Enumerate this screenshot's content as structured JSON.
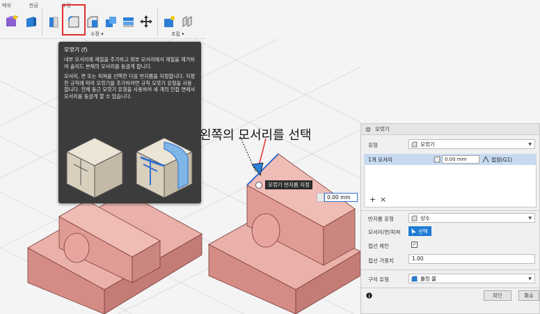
{
  "toolbar": {
    "groups": [
      "메쉬",
      "판금",
      "수정"
    ],
    "sub_modify": "수정 ▾",
    "sub_assemble": "조립 ▾"
  },
  "tooltip": {
    "title": "모깎기 (f)",
    "para1": "내부 모서리에 재질을 추가하고 외부 모서리에서 재질을 제거하여 솔리드 본체의 모서리를 둥글게 합니다.",
    "para2": "모서리, 면 또는 피쳐를 선택한 다음 반지름을 지정합니다. 지정한 규칙에 따라 모깎기를 추가하려면 규칙 모깎기 유형을 사용합니다. 전체 둥근 모깎기 유형을 사용하여 세 개의 인접 면에서 모서리를 둥글게 할 수 있습니다."
  },
  "annotation": "왼쪽의 모서리를 선택",
  "viewport": {
    "fillet_tag": "모깎기 반지름 지정",
    "radius_value": "0.00 mm"
  },
  "panel": {
    "title": "모깎기",
    "type_label": "유형",
    "type_value": "모깎기",
    "edge_count": "1개 모서리",
    "edge_radius": "0.00 mm",
    "edge_continuity": "접점(G1)",
    "radius_type_label": "반지름 유형",
    "radius_type_value": "상수",
    "edge_face_label": "모서리/면/피쳐",
    "select_label": "선택",
    "tangent_chain_label": "접선 체인",
    "tangent_weight_label": "접선 가중치",
    "tangent_weight_value": "1.00",
    "corner_type_label": "구석 유형",
    "corner_type_value": "롤링 볼",
    "ok_label": "확인",
    "cancel_label": "취소",
    "add_symbol": "+",
    "remove_symbol": "×"
  },
  "colors": {
    "accent": "#1e7bd3",
    "highlight": "#e32b2b",
    "body": "#e8a5a0",
    "tooltip_bg": "#3c3c3c"
  }
}
